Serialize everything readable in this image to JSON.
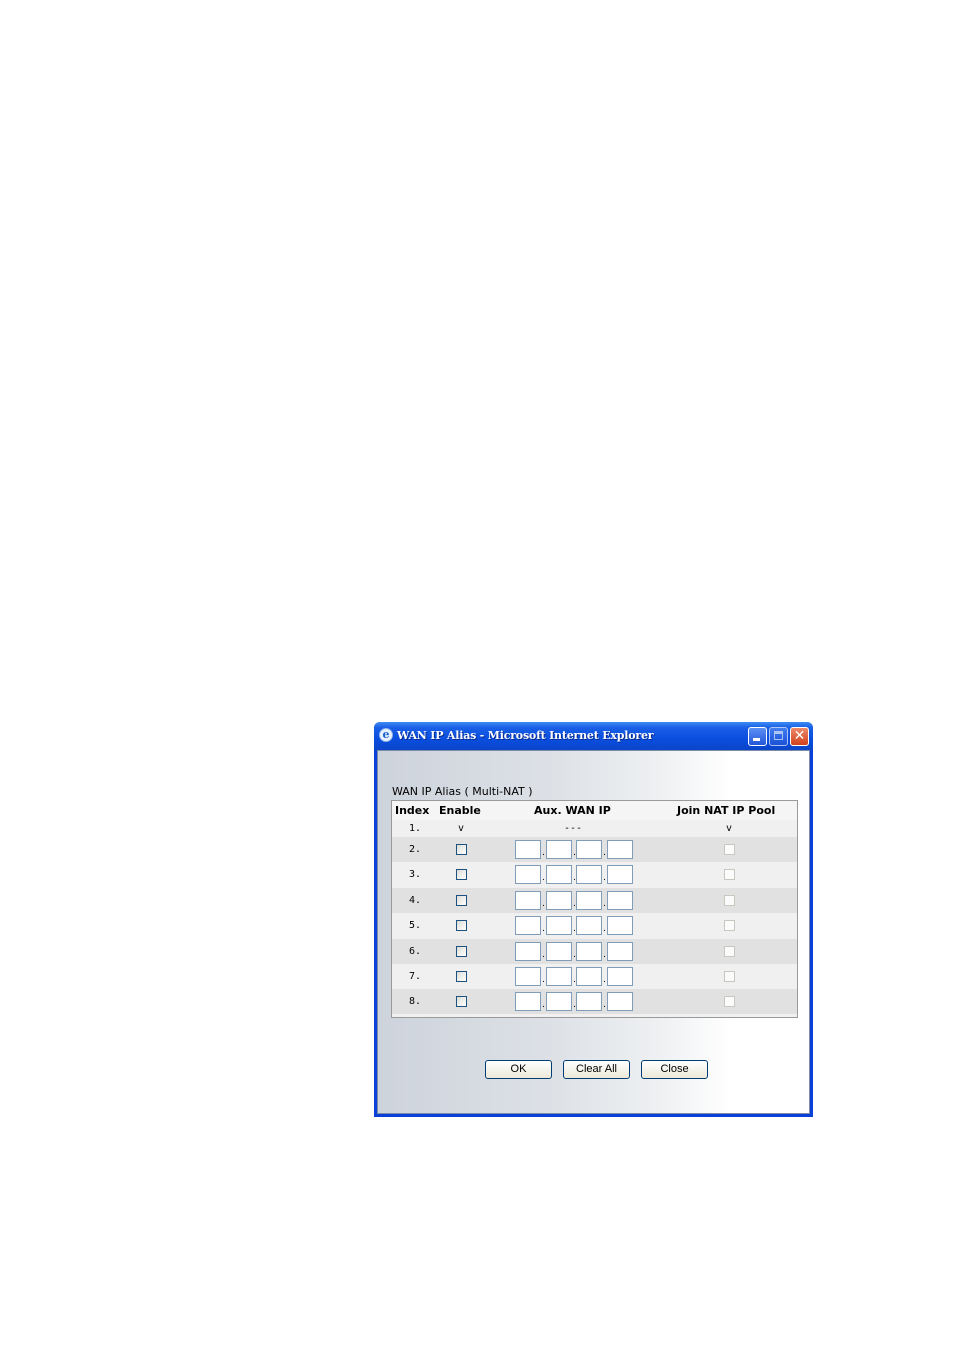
{
  "window": {
    "title": "WAN IP Alias - Microsoft Internet Explorer",
    "controls": {
      "minimize": "minimize-icon",
      "maximize": "maximize-icon",
      "close": "close-icon"
    }
  },
  "page": {
    "heading": "WAN IP Alias ( Multi-NAT )",
    "columns": {
      "index": "Index",
      "enable": "Enable",
      "aux_wan_ip": "Aux. WAN IP",
      "join_nat": "Join NAT IP Pool"
    },
    "first_row": {
      "index": "1.",
      "enable": "v",
      "aux_wan_ip": "---",
      "join_nat": "v"
    },
    "rows": [
      {
        "index": "2.",
        "enabled": false,
        "ip": [
          "",
          "",
          "",
          ""
        ],
        "join_nat": false
      },
      {
        "index": "3.",
        "enabled": false,
        "ip": [
          "",
          "",
          "",
          ""
        ],
        "join_nat": false
      },
      {
        "index": "4.",
        "enabled": false,
        "ip": [
          "",
          "",
          "",
          ""
        ],
        "join_nat": false
      },
      {
        "index": "5.",
        "enabled": false,
        "ip": [
          "",
          "",
          "",
          ""
        ],
        "join_nat": false
      },
      {
        "index": "6.",
        "enabled": false,
        "ip": [
          "",
          "",
          "",
          ""
        ],
        "join_nat": false
      },
      {
        "index": "7.",
        "enabled": false,
        "ip": [
          "",
          "",
          "",
          ""
        ],
        "join_nat": false
      },
      {
        "index": "8.",
        "enabled": false,
        "ip": [
          "",
          "",
          "",
          ""
        ],
        "join_nat": false
      }
    ],
    "ip_separator": ".",
    "buttons": {
      "ok": "OK",
      "clear_all": "Clear All",
      "close": "Close"
    }
  }
}
